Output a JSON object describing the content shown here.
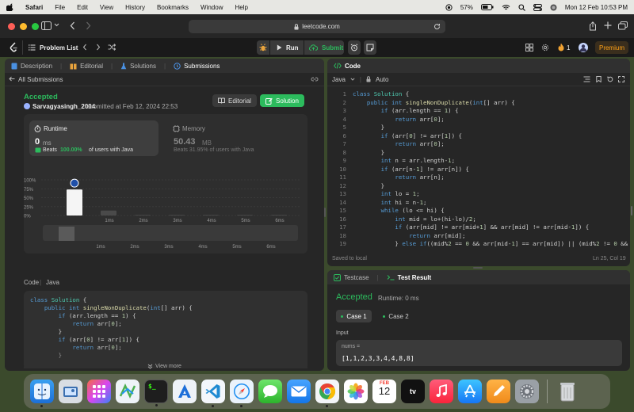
{
  "menubar": {
    "app": "Safari",
    "items": [
      "File",
      "Edit",
      "View",
      "History",
      "Bookmarks",
      "Window",
      "Help"
    ],
    "battery": "57%",
    "datetime": "Mon 12 Feb  10:53 PM"
  },
  "safari": {
    "url": "leetcode.com"
  },
  "leetcode": {
    "problem_list": "Problem List",
    "run": "Run",
    "submit": "Submit",
    "streak": "1",
    "premium": "Premium"
  },
  "left": {
    "tabs": [
      "Description",
      "Editorial",
      "Solutions",
      "Submissions"
    ],
    "all_submissions": "All Submissions",
    "status": "Accepted",
    "user": "Sarvagyasingh_2004",
    "submitted_at": "submitted at Feb 12, 2024 22:53",
    "editorial_btn": "Editorial",
    "solution_btn": "Solution",
    "runtime": {
      "label": "Runtime",
      "value": "0",
      "unit": "ms",
      "beats_prefix": "Beats",
      "beats_value": "100.00%",
      "beats_suffix": "of users with Java"
    },
    "memory": {
      "label": "Memory",
      "value": "50.43",
      "unit": "MB",
      "beats_text": "Beats 31.95% of users with Java"
    },
    "code_label": "Code",
    "lang_label": "Java",
    "view_more": "View more",
    "code_preview": [
      "class Solution {",
      "    public int singleNonDuplicate(int[] arr) {",
      "        if (arr.length == 1) {",
      "            return arr[0];",
      "        }",
      "        if (arr[0] != arr[1]) {",
      "            return arr[0];",
      "        }"
    ]
  },
  "chart_data": {
    "type": "bar",
    "categories": [
      "0ms",
      "1ms",
      "2ms",
      "3ms",
      "4ms",
      "5ms",
      "6ms"
    ],
    "values": [
      73,
      14,
      2,
      2,
      2,
      2,
      2
    ],
    "yticks": [
      "100%",
      "75%",
      "50%",
      "25%",
      "0%"
    ],
    "ylim": [
      0,
      100
    ],
    "highlight": "0ms",
    "overview_labels": [
      "1ms",
      "2ms",
      "3ms",
      "4ms",
      "5ms",
      "6ms"
    ]
  },
  "editor": {
    "title": "Code",
    "language": "Java",
    "mode": "Auto",
    "saved": "Saved to local",
    "cursor": "Ln 25, Col 19",
    "line_numbers": [
      "1",
      "2",
      "3",
      "4",
      "5",
      "6",
      "7",
      "8",
      "9",
      "10",
      "11",
      "12",
      "13",
      "14",
      "15",
      "16",
      "17",
      "18",
      "19"
    ]
  },
  "testcase": {
    "tab1": "Testcase",
    "tab2": "Test Result",
    "status": "Accepted",
    "runtime": "Runtime: 0 ms",
    "case1": "Case 1",
    "case2": "Case 2",
    "input_label": "Input",
    "var_name": "nums =",
    "var_value": "[1,1,2,3,3,4,4,8,8]"
  },
  "dock": {
    "calendar_month": "FEB",
    "calendar_day": "12"
  }
}
